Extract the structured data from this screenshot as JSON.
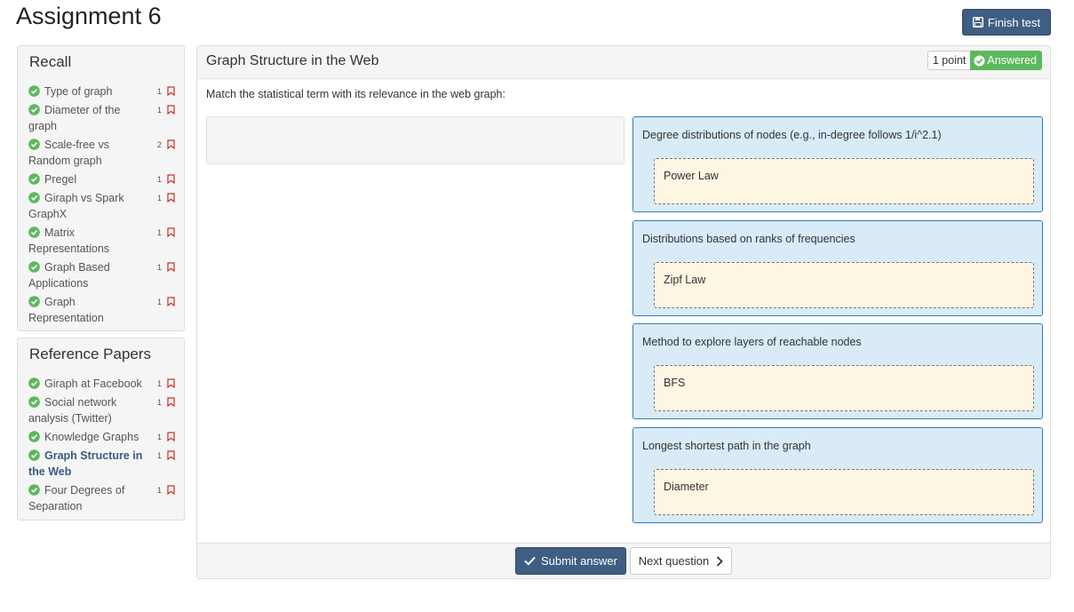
{
  "page": {
    "title": "Assignment 6"
  },
  "toolbar": {
    "finish_label": "Finish test"
  },
  "sidebar": {
    "recall": {
      "heading": "Recall",
      "items": [
        {
          "label": "Type of graph",
          "points": "1"
        },
        {
          "label": "Diameter of the graph",
          "points": "1"
        },
        {
          "label": "Scale-free vs Random graph",
          "points": "2"
        },
        {
          "label": "Pregel",
          "points": "1"
        },
        {
          "label": "Giraph vs Spark GraphX",
          "points": "1"
        },
        {
          "label": "Matrix Representations",
          "points": "1"
        },
        {
          "label": "Graph Based Applications",
          "points": "1"
        },
        {
          "label": "Graph Representation",
          "points": "1"
        }
      ]
    },
    "papers": {
      "heading": "Reference Papers",
      "items": [
        {
          "label": "Giraph at Facebook",
          "points": "1"
        },
        {
          "label": "Social network analysis (Twitter)",
          "points": "1"
        },
        {
          "label": "Knowledge Graphs",
          "points": "1"
        },
        {
          "label": "Graph Structure in the Web",
          "points": "1"
        },
        {
          "label": "Four Degrees of Separation",
          "points": "1"
        }
      ]
    }
  },
  "question": {
    "title": "Graph Structure in the Web",
    "points_label": "1 point",
    "status_label": "Answered",
    "prompt": "Match the statistical term with its relevance in the web graph:",
    "matches": [
      {
        "term": "Degree distributions of nodes (e.g., in-degree follows 1/i^2.1)",
        "answer": "Power Law"
      },
      {
        "term": "Distributions based on ranks of frequencies",
        "answer": "Zipf Law"
      },
      {
        "term": "Method to explore layers of reachable nodes",
        "answer": "BFS"
      },
      {
        "term": "Longest shortest path in the graph",
        "answer": "Diameter"
      }
    ]
  },
  "footer": {
    "submit_label": "Submit answer",
    "next_label": "Next question"
  },
  "colors": {
    "primary": "#3f5e84",
    "success": "#5cb85c",
    "match_bg": "#d9ebf7",
    "match_border": "#2b7bc4",
    "drop_bg": "#fcf6e3",
    "bookmark": "#c9302c"
  }
}
